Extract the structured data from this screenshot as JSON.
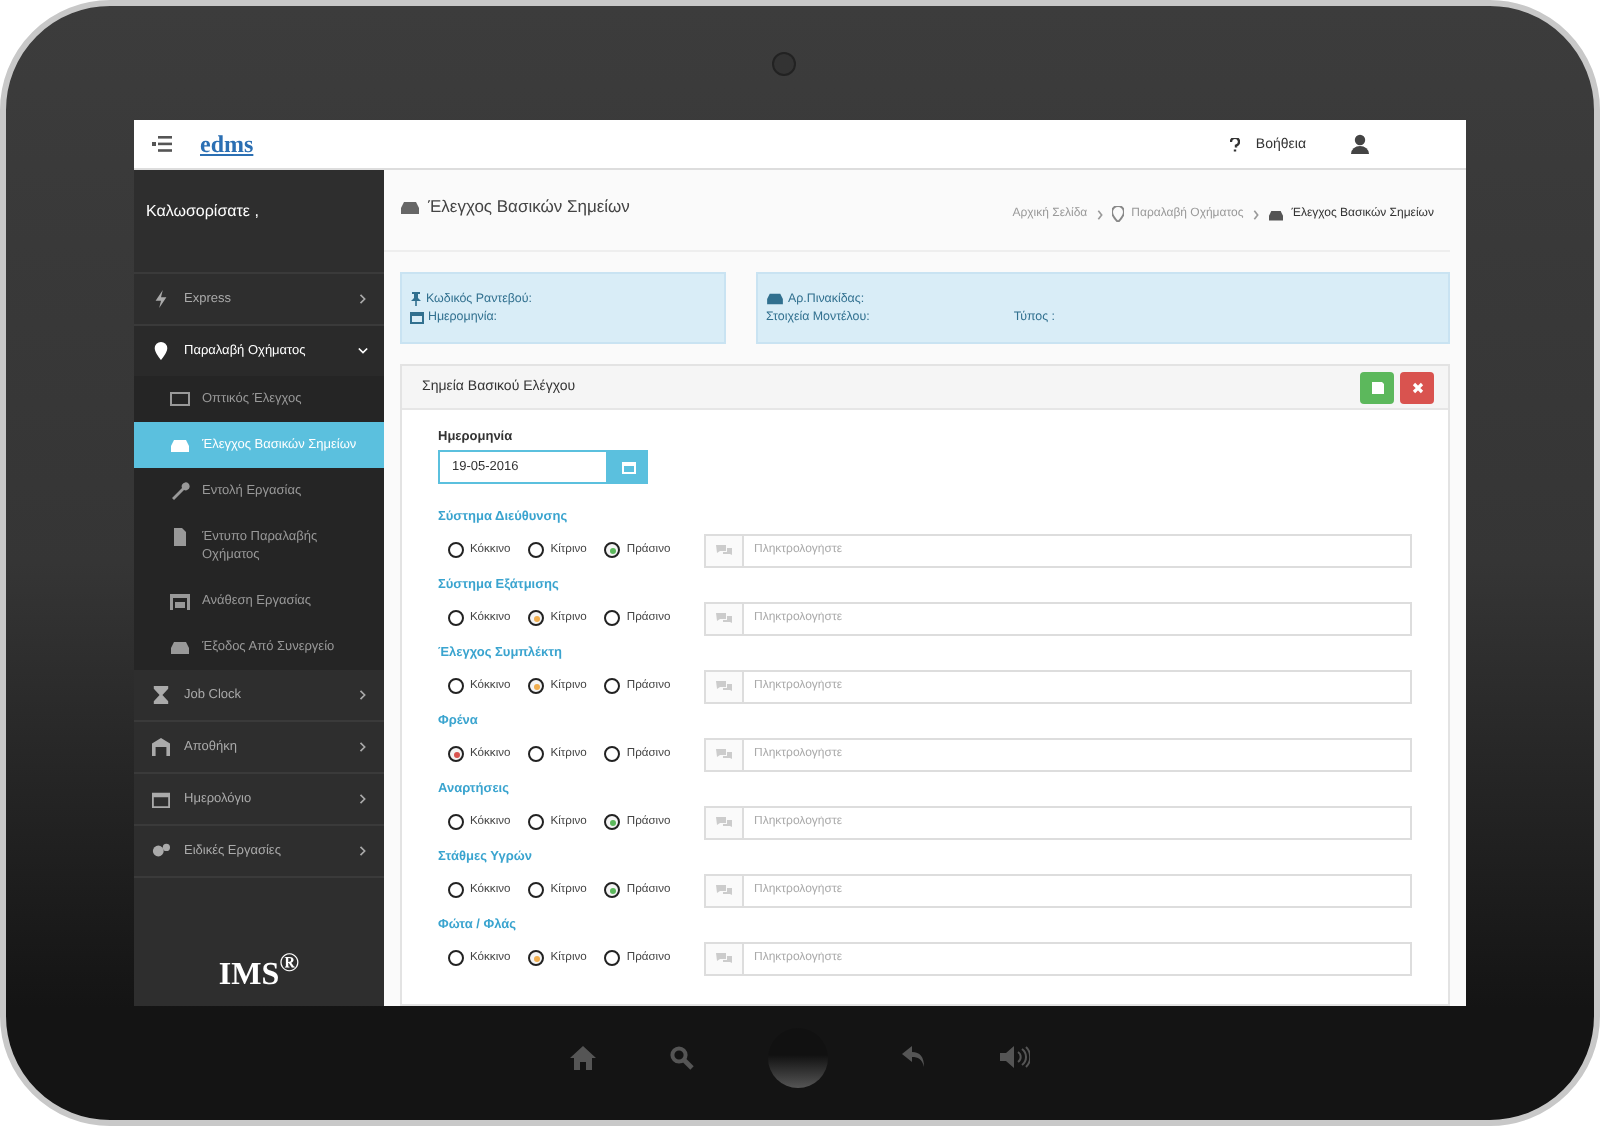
{
  "topbar": {
    "logo": "edms",
    "help": "Βοήθεια"
  },
  "sidebar": {
    "welcome": "Καλωσορίσατε ,",
    "items": [
      {
        "label": "Express",
        "selected": false,
        "expanded": false
      },
      {
        "label": "Παραλαβή Οχήματος",
        "selected": false,
        "expanded": true,
        "children": [
          {
            "label": "Οπτικός Έλεγχος",
            "selected": false
          },
          {
            "label": "Έλεγχος Βασικών Σημείων",
            "selected": true
          },
          {
            "label": "Εντολή Εργασίας",
            "selected": false
          },
          {
            "label": "Έντυπο Παραλαβής Οχήματος",
            "selected": false
          },
          {
            "label": "Ανάθεση Εργασίας",
            "selected": false
          },
          {
            "label": "Έξοδος Από Συνεργείο",
            "selected": false
          }
        ]
      },
      {
        "label": "Job Clock",
        "selected": false,
        "expanded": false
      },
      {
        "label": "Αποθήκη",
        "selected": false,
        "expanded": false
      },
      {
        "label": "Ημερολόγιο",
        "selected": false,
        "expanded": false
      },
      {
        "label": "Ειδικές Εργασίες",
        "selected": false,
        "expanded": false
      }
    ],
    "brand": "IMS$^{®}$"
  },
  "page": {
    "title": "Έλεγχος Βασικών Σημείων",
    "breadcrumb": [
      "Αρχική Σελίδα",
      "Παραλαβή Οχήματος",
      "Έλεγχος Βασικών Σημείων"
    ]
  },
  "info": {
    "appointment_code": "Κωδικός Ραντεβού:",
    "date": "Ημερομηνία:",
    "plate": "Αρ.Πινακίδας:",
    "model": "Στοιχεία Μοντέλου:",
    "type": "Τύπος :"
  },
  "panel": {
    "title": "Σημεία Βασικού Ελέγχου",
    "date_label": "Ημερομηνία",
    "date_value": "19-05-2016",
    "checks": [
      {
        "label": "Σύστημα Διεύθυνσης",
        "placeholder": "Πληκτρολογήστε",
        "options": [
          {
            "label": "Κόκκινο",
            "selected": false
          },
          {
            "label": "Κίτρινο",
            "selected": false
          },
          {
            "label": "Πράσινο",
            "selected": true
          }
        ]
      },
      {
        "label": "Σύστημα Εξάτμισης",
        "placeholder": "Πληκτρολογήστε",
        "options": [
          {
            "label": "Κόκκινο",
            "selected": false
          },
          {
            "label": "Κίτρινο",
            "selected": true
          },
          {
            "label": "Πράσινο",
            "selected": false
          }
        ]
      },
      {
        "label": "Έλεγχος Συμπλέκτη",
        "placeholder": "Πληκτρολογήστε",
        "options": [
          {
            "label": "Κόκκινο",
            "selected": false
          },
          {
            "label": "Κίτρινο",
            "selected": true
          },
          {
            "label": "Πράσινο",
            "selected": false
          }
        ]
      },
      {
        "label": "Φρένα",
        "placeholder": "Πληκτρολογήστε",
        "options": [
          {
            "label": "Κόκκινο",
            "selected": true
          },
          {
            "label": "Κίτρινο",
            "selected": false
          },
          {
            "label": "Πράσινο",
            "selected": false
          }
        ]
      },
      {
        "label": "Αναρτήσεις",
        "placeholder": "Πληκτρολογήστε",
        "options": [
          {
            "label": "Κόκκινο",
            "selected": false
          },
          {
            "label": "Κίτρινο",
            "selected": false
          },
          {
            "label": "Πράσινο",
            "selected": true
          }
        ]
      },
      {
        "label": "Στάθμες Υγρών",
        "placeholder": "Πληκτρολογήστε",
        "options": [
          {
            "label": "Κόκκινο",
            "selected": false
          },
          {
            "label": "Κίτρινο",
            "selected": false
          },
          {
            "label": "Πράσινο",
            "selected": true
          }
        ]
      },
      {
        "label": "Φώτα / Φλάς",
        "placeholder": "Πληκτρολογήστε",
        "options": [
          {
            "label": "Κόκκινο",
            "selected": false
          },
          {
            "label": "Κίτρινο",
            "selected": true
          },
          {
            "label": "Πράσινο",
            "selected": false
          }
        ]
      }
    ]
  }
}
